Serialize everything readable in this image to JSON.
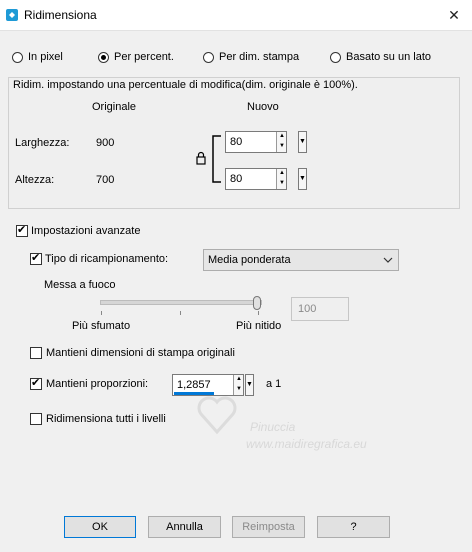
{
  "window": {
    "title": "Ridimensiona",
    "close_glyph": "✕"
  },
  "resize_mode": {
    "options": [
      {
        "label": "In pixel",
        "selected": false
      },
      {
        "label": "Per percent.",
        "selected": true
      },
      {
        "label": "Per dim. stampa",
        "selected": false
      },
      {
        "label": "Basato su un lato",
        "selected": false
      }
    ]
  },
  "percent_group": {
    "caption": "Ridim. impostando una percentuale di modifica(dim. originale è 100%).",
    "original_header": "Originale",
    "new_header": "Nuovo",
    "width_label": "Larghezza:",
    "width_original": "900",
    "width_new": "80",
    "height_label": "Altezza:",
    "height_original": "700",
    "height_new": "80",
    "lock_icon": "lock-icon"
  },
  "advanced": {
    "label": "Impostazioni avanzate",
    "checked": true,
    "resample_label": "Tipo di ricampionamento:",
    "resample_checked": true,
    "resample_value": "Media ponderata",
    "focus_label": "Messa a fuoco",
    "focus_min_label": "Più sfumato",
    "focus_max_label": "Più nitido",
    "focus_value": "100",
    "focus_level": 1.0,
    "keep_print_size_label": "Mantieni dimensioni di stampa originali",
    "keep_print_size_checked": false,
    "keep_ratio_label": "Mantieni proporzioni:",
    "keep_ratio_checked": true,
    "ratio_value": "1,2857",
    "ratio_suffix": "a 1",
    "resize_all_layers_label": "Ridimensiona tutti i livelli",
    "resize_all_layers_checked": false
  },
  "watermark": {
    "line1": "Pinuccia",
    "line2": "www.maidiregrafica.eu"
  },
  "buttons": {
    "ok": "OK",
    "cancel": "Annulla",
    "reset": "Reimposta",
    "help": "?"
  },
  "colors": {
    "accent": "#0078d7",
    "icon": "#1e9ad6"
  }
}
